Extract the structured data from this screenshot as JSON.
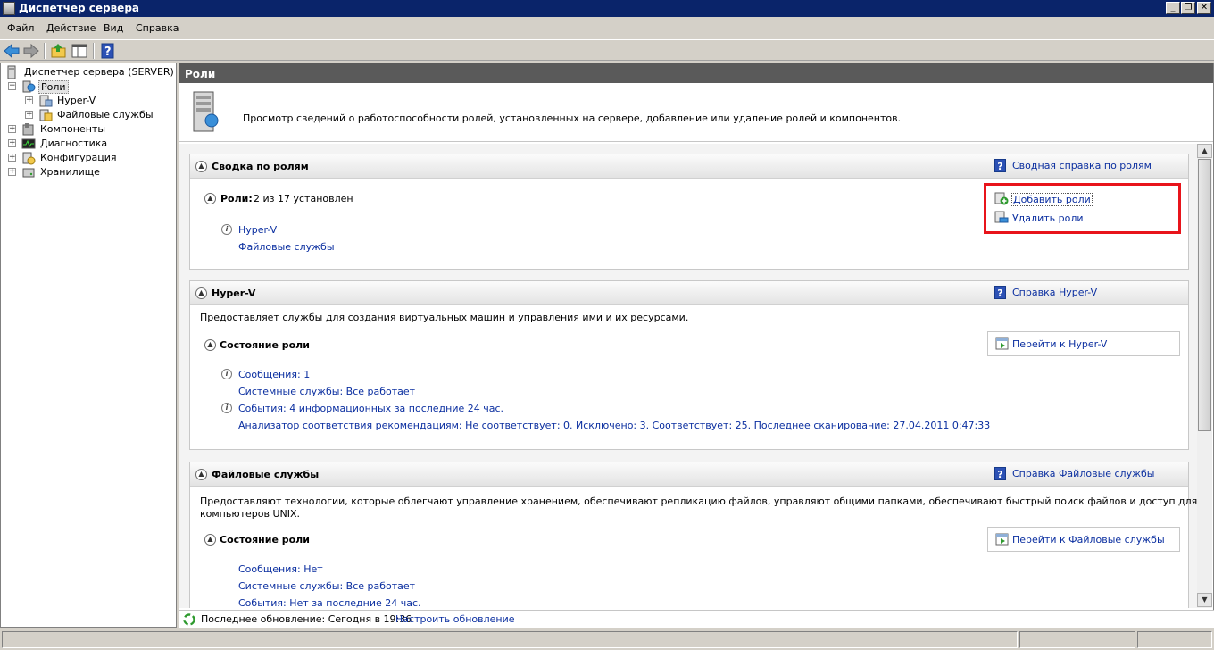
{
  "window": {
    "title": "Диспетчер сервера"
  },
  "menu": [
    "Файл",
    "Действие",
    "Вид",
    "Справка"
  ],
  "toolbar": {
    "icons": [
      "back-icon",
      "forward-icon",
      "up-icon",
      "console-tree-icon",
      "help-icon"
    ]
  },
  "tree": {
    "root": "Диспетчер сервера (SERVER)",
    "items": [
      {
        "label": "Роли",
        "expander": "−",
        "level": 1,
        "selected": true
      },
      {
        "label": "Hyper-V",
        "expander": "+",
        "level": 2
      },
      {
        "label": "Файловые службы",
        "expander": "+",
        "level": 2
      },
      {
        "label": "Компоненты",
        "expander": "+",
        "level": 1
      },
      {
        "label": "Диагностика",
        "expander": "+",
        "level": 1
      },
      {
        "label": "Конфигурация",
        "expander": "+",
        "level": 1
      },
      {
        "label": "Хранилище",
        "expander": "+",
        "level": 1
      }
    ]
  },
  "main": {
    "header": "Роли",
    "description": "Просмотр сведений о работоспособности ролей, установленных на сервере, добавление или удаление ролей и компонентов.",
    "summary": {
      "title": "Сводка по ролям",
      "help_link": "Сводная справка по ролям",
      "roles_label": "Роли:",
      "roles_value": "2 из 17 установлен",
      "roles": [
        "Hyper-V",
        "Файловые службы"
      ],
      "add_roles": "Добавить роли",
      "remove_roles": "Удалить роли"
    },
    "hyperv": {
      "title": "Hyper-V",
      "help_link": "Справка Hyper-V",
      "description": "Предоставляет службы для создания виртуальных машин и управления ими и их ресурсами.",
      "status_title": "Состояние роли",
      "goto": "Перейти к Hyper-V",
      "messages": "Сообщения: 1",
      "services": "Системные службы: Все работает",
      "events": "События: 4 информационных за последние 24 час.",
      "bpa": "Анализатор соответствия рекомендациям: Не соответствует: 0. Исключено: 3. Соответствует: 25. Последнее сканирование: 27.04.2011 0:47:33"
    },
    "fileservices": {
      "title": "Файловые службы",
      "help_link": "Справка Файловые службы",
      "description_line1": "Предоставляют технологии, которые облегчают управление хранением, обеспечивают репликацию файлов, управляют общими папками, обеспечивают быстрый поиск файлов и доступ для клиентских",
      "description_line2": "компьютеров UNIX.",
      "status_title": "Состояние роли",
      "goto": "Перейти к Файловые службы",
      "messages": "Сообщения: Нет",
      "services": "Системные службы: Все работает",
      "events": "События: Нет за последние 24 час."
    }
  },
  "status": {
    "last_update": "Последнее обновление: Сегодня в 19:36",
    "configure": "Настроить обновление"
  },
  "highlight_color": "#e8141b"
}
